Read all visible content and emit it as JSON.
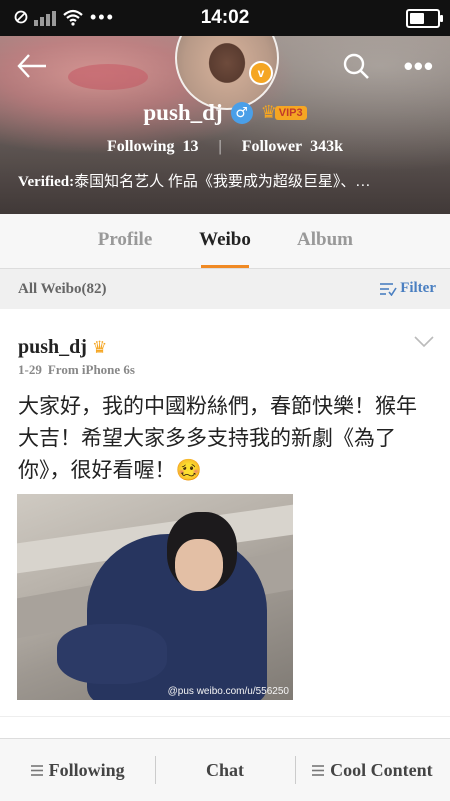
{
  "status_bar": {
    "time": "14:02",
    "signal_icon": "signal-icon",
    "wifi_icon": "wifi-icon",
    "dots": "•••",
    "battery_level": 0.5
  },
  "profile": {
    "username": "push_dj",
    "gender_icon": "♂",
    "vip_label": "VIP3",
    "following_label": "Following",
    "following_count": "13",
    "follower_label": "Follower",
    "follower_count": "343k",
    "verified_label": "Verified:",
    "verified_text": "泰国知名艺人 作品《我要成为超级巨星》、…",
    "avatar_badge": "v"
  },
  "header_icons": {
    "back": "back-arrow-icon",
    "search": "search-icon",
    "more": "•••"
  },
  "tabs": [
    {
      "label": "Profile",
      "active": false
    },
    {
      "label": "Weibo",
      "active": true
    },
    {
      "label": "Album",
      "active": false
    }
  ],
  "filter_bar": {
    "all_weibo": "All Weibo(82)",
    "filter_label": "Filter"
  },
  "post": {
    "author": "push_dj",
    "date": "1-29",
    "source": "From iPhone 6s",
    "text": "大家好，我的中國粉絲們，春節快樂！猴年大吉！希望大家多多支持我的新劇《為了你》，很好看喔！🥴",
    "image_watermark": "@pus weibo.com/u/556250"
  },
  "bottom_bar": {
    "following": "Following",
    "chat": "Chat",
    "cool_content": "Cool Content"
  }
}
